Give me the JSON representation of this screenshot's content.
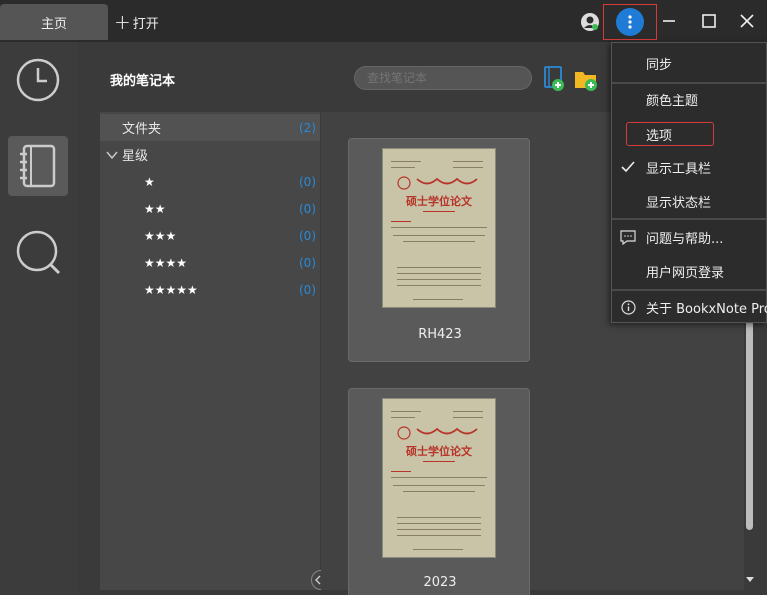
{
  "titlebar": {
    "home_tab": "主页",
    "open_label": "打开"
  },
  "main": {
    "notebook_title": "我的笔记本",
    "search_placeholder": "查找笔记本"
  },
  "tree": {
    "folder_label": "文件夹",
    "folder_count": "(2)",
    "rating_label": "星级",
    "ratings": [
      {
        "stars": "★",
        "count": "(0)"
      },
      {
        "stars": "★★",
        "count": "(0)"
      },
      {
        "stars": "★★★",
        "count": "(0)"
      },
      {
        "stars": "★★★★",
        "count": "(0)"
      },
      {
        "stars": "★★★★★",
        "count": "(0)"
      }
    ]
  },
  "cards": [
    {
      "label": "RH423",
      "thesis_title": "硕士学位论文"
    },
    {
      "label": "2023",
      "thesis_title": "硕士学位论文"
    }
  ],
  "menu": {
    "items": [
      {
        "label": "同步"
      },
      {
        "label": "颜色主题"
      },
      {
        "label": "选项"
      },
      {
        "label": "显示工具栏"
      },
      {
        "label": "显示状态栏"
      },
      {
        "label": "问题与帮助..."
      },
      {
        "label": "用户网页登录"
      },
      {
        "label": "关于 BookxNote Pro"
      }
    ]
  },
  "colors": {
    "accent": "#1e7bd6",
    "count_blue": "#2a8ad8",
    "highlight_red": "#d63b3b"
  }
}
